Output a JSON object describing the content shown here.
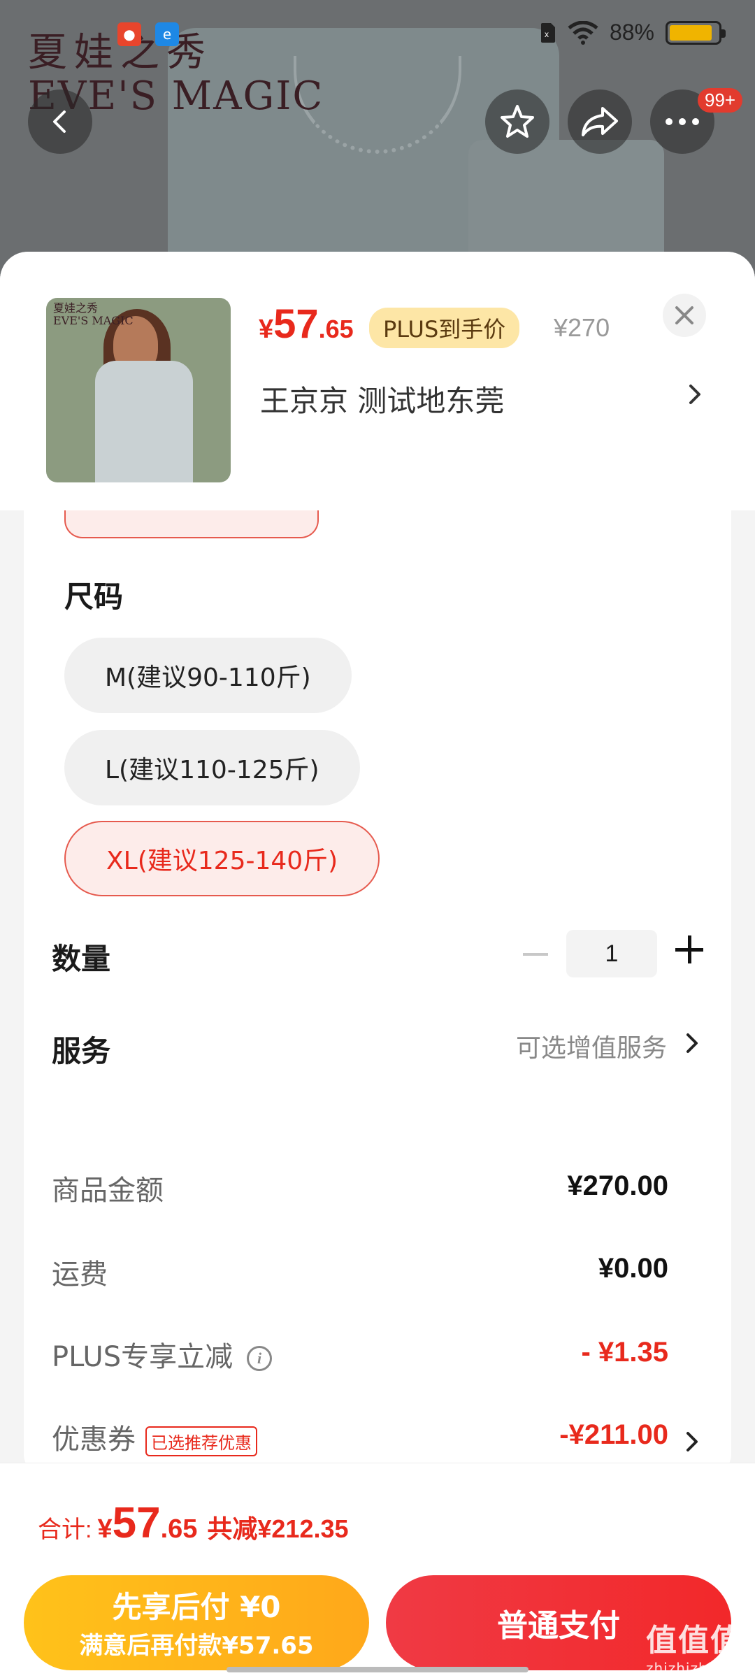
{
  "status_bar": {
    "battery": "88%",
    "battery_level": 0.88
  },
  "brand": {
    "name_cn": "夏娃之秀",
    "name_en": "EVE'S MAGIC"
  },
  "page_nav": {
    "cart_badge": "99+"
  },
  "product": {
    "price_symbol": "¥",
    "price_int": "57",
    "price_dec": ".65",
    "plus_tag": "PLUS到手价",
    "original_price": "¥270",
    "address": "王京京  测试地东莞"
  },
  "options": {
    "size_title": "尺码",
    "sizes": [
      {
        "label": "M(建议90-110斤)",
        "selected": false
      },
      {
        "label": "L(建议110-125斤)",
        "selected": false
      },
      {
        "label": "XL(建议125-140斤)",
        "selected": true
      }
    ],
    "quantity_label": "数量",
    "quantity": "1",
    "service_label": "服务",
    "service_hint": "可选增值服务"
  },
  "summary": {
    "goods_label": "商品金额",
    "goods_value": "¥270.00",
    "shipping_label": "运费",
    "shipping_value": "¥0.00",
    "plus_label": "PLUS专享立减",
    "plus_value": "- ¥1.35",
    "coupon_label": "优惠券",
    "coupon_tag": "已选推荐优惠",
    "coupon_value": "-¥211.00"
  },
  "footer": {
    "total_label": "合计:",
    "total_symbol": "¥",
    "total_int": "57",
    "total_dec": ".65",
    "total_saved": "共减¥212.35",
    "pay_later_line1": "先享后付 ¥0",
    "pay_later_line2": "满意后再付款¥57.65",
    "pay_normal": "普通支付"
  },
  "watermark": {
    "main": "值值值",
    "sub": "zhizhizhi.com"
  },
  "colors": {
    "accent": "#e8291c",
    "pay_later": "#ffb81a",
    "pay_normal": "#f03a44",
    "plus_tag_bg": "#fde6a6"
  },
  "icons": [
    "back-icon",
    "star-icon",
    "share-icon",
    "more-icon",
    "close-icon",
    "chevron-right-icon",
    "info-icon",
    "wifi-icon",
    "sim-icon"
  ]
}
